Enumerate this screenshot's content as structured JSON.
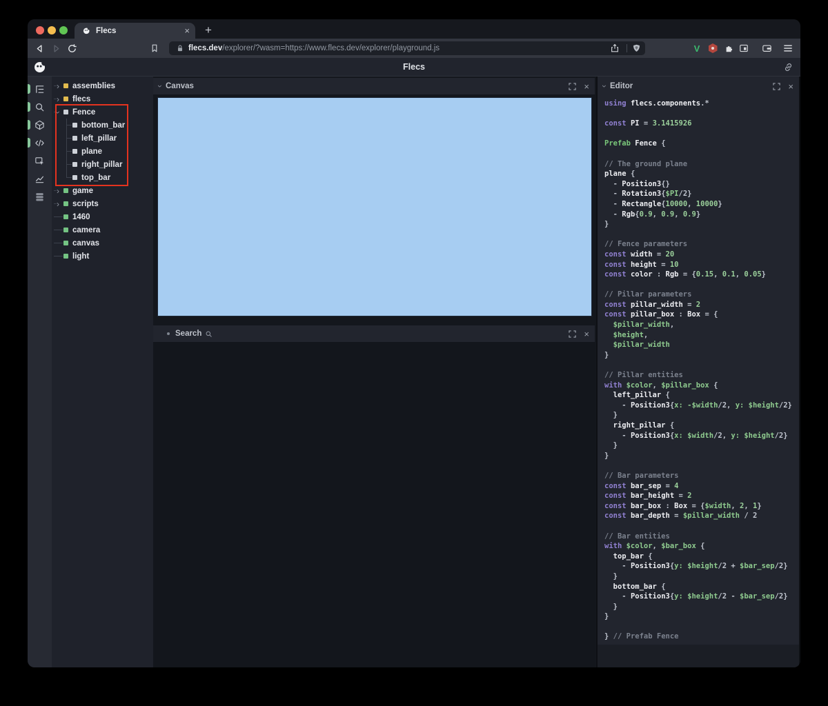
{
  "icons": {
    "close": "×",
    "plus": "+",
    "chevron": "›",
    "link": "link-icon",
    "lock": "lock-icon",
    "search": "magnifier-icon"
  },
  "browser": {
    "tab_title": "Flecs",
    "url_domain": "flecs.dev",
    "url_path": "/explorer/?wasm=https://www.flecs.dev/explorer/playground.js",
    "extensions": [
      "vue-devtools",
      "red-hexagon-extension",
      "extensions-puzzle",
      "reader-panel",
      "wallet",
      "menu"
    ]
  },
  "app_header": {
    "title": "Flecs"
  },
  "sidebar": {
    "active_color": "#87c79b",
    "icons": [
      {
        "name": "outliner-tree-icon",
        "active": true
      },
      {
        "name": "search-icon",
        "active": true
      },
      {
        "name": "scene-cube-icon",
        "active": true
      },
      {
        "name": "code-icon",
        "active": true
      },
      {
        "name": "inspector-icon",
        "active": false
      },
      {
        "name": "stats-chart-icon",
        "active": false
      },
      {
        "name": "rows-stack-icon",
        "active": false
      }
    ]
  },
  "tree": {
    "items": [
      {
        "label": "assemblies",
        "marker": "collapsed",
        "color": "#e2bb4e",
        "depth": 0
      },
      {
        "label": "flecs",
        "marker": "collapsed",
        "color": "#e2bb4e",
        "depth": 0
      },
      {
        "label": "Fence",
        "marker": "expanded",
        "color": "#ccd0d7",
        "depth": 0
      },
      {
        "label": "bottom_bar",
        "marker": "child",
        "color": "#ccd0d7",
        "depth": 1
      },
      {
        "label": "left_pillar",
        "marker": "child",
        "color": "#ccd0d7",
        "depth": 1
      },
      {
        "label": "plane",
        "marker": "child",
        "color": "#ccd0d7",
        "depth": 1
      },
      {
        "label": "right_pillar",
        "marker": "child",
        "color": "#ccd0d7",
        "depth": 1
      },
      {
        "label": "top_bar",
        "marker": "child",
        "color": "#ccd0d7",
        "depth": 1,
        "last": true
      },
      {
        "label": "game",
        "marker": "collapsed",
        "color": "#74c383",
        "depth": 0
      },
      {
        "label": "scripts",
        "marker": "collapsed",
        "color": "#74c383",
        "depth": 0
      },
      {
        "label": "1460",
        "marker": "leaf",
        "color": "#74c383",
        "depth": 0
      },
      {
        "label": "camera",
        "marker": "leaf",
        "color": "#74c383",
        "depth": 0
      },
      {
        "label": "canvas",
        "marker": "leaf",
        "color": "#74c383",
        "depth": 0
      },
      {
        "label": "light",
        "marker": "leaf",
        "color": "#74c383",
        "depth": 0
      }
    ],
    "annotation_color": "#e5331f"
  },
  "panels": {
    "canvas_title": "Canvas",
    "search_title": "Search",
    "editor_title": "Editor"
  },
  "colors": {
    "canvas_blue": "#a7cdf2",
    "annotation_red": "#e5331f",
    "active_green": "#87c79b"
  },
  "editor": {
    "lines": [
      [
        [
          "k",
          "using "
        ],
        [
          "i",
          "flecs.components"
        ],
        [
          "p",
          ".*"
        ]
      ],
      [],
      [
        [
          "k",
          "const "
        ],
        [
          "i",
          "PI "
        ],
        [
          "p",
          "= "
        ],
        [
          "n",
          "3.1415926"
        ]
      ],
      [],
      [
        [
          "g",
          "Prefab "
        ],
        [
          "i",
          "Fence "
        ],
        [
          "p",
          "{"
        ]
      ],
      [],
      [
        [
          "c",
          "// The ground plane"
        ]
      ],
      [
        [
          "i",
          "plane "
        ],
        [
          "p",
          "{"
        ]
      ],
      [
        [
          "p",
          "  - "
        ],
        [
          "i",
          "Position3"
        ],
        [
          "p",
          "{}"
        ]
      ],
      [
        [
          "p",
          "  - "
        ],
        [
          "i",
          "Rotation3"
        ],
        [
          "p",
          "{"
        ],
        [
          "v",
          "$PI"
        ],
        [
          "p",
          "/2}"
        ]
      ],
      [
        [
          "p",
          "  - "
        ],
        [
          "i",
          "Rectangle"
        ],
        [
          "p",
          "{"
        ],
        [
          "n",
          "10000"
        ],
        [
          "p",
          ", "
        ],
        [
          "n",
          "10000"
        ],
        [
          "p",
          "}"
        ]
      ],
      [
        [
          "p",
          "  - "
        ],
        [
          "i",
          "Rgb"
        ],
        [
          "p",
          "{"
        ],
        [
          "n",
          "0.9"
        ],
        [
          "p",
          ", "
        ],
        [
          "n",
          "0.9"
        ],
        [
          "p",
          ", "
        ],
        [
          "n",
          "0.9"
        ],
        [
          "p",
          "}"
        ]
      ],
      [
        [
          "p",
          "}"
        ]
      ],
      [],
      [
        [
          "c",
          "// Fence parameters"
        ]
      ],
      [
        [
          "k",
          "const "
        ],
        [
          "i",
          "width "
        ],
        [
          "p",
          "= "
        ],
        [
          "n",
          "20"
        ]
      ],
      [
        [
          "k",
          "const "
        ],
        [
          "i",
          "height "
        ],
        [
          "p",
          "= "
        ],
        [
          "n",
          "10"
        ]
      ],
      [
        [
          "k",
          "const "
        ],
        [
          "i",
          "color "
        ],
        [
          "p",
          ": "
        ],
        [
          "i",
          "Rgb "
        ],
        [
          "p",
          "= {"
        ],
        [
          "n",
          "0.15"
        ],
        [
          "p",
          ", "
        ],
        [
          "n",
          "0.1"
        ],
        [
          "p",
          ", "
        ],
        [
          "n",
          "0.05"
        ],
        [
          "p",
          "}"
        ]
      ],
      [],
      [
        [
          "c",
          "// Pillar parameters"
        ]
      ],
      [
        [
          "k",
          "const "
        ],
        [
          "i",
          "pillar_width "
        ],
        [
          "p",
          "= "
        ],
        [
          "n",
          "2"
        ]
      ],
      [
        [
          "k",
          "const "
        ],
        [
          "i",
          "pillar_box "
        ],
        [
          "p",
          ": "
        ],
        [
          "i",
          "Box "
        ],
        [
          "p",
          "= {"
        ]
      ],
      [
        [
          "v",
          "  $pillar_width"
        ],
        [
          "p",
          ","
        ]
      ],
      [
        [
          "v",
          "  $height"
        ],
        [
          "p",
          ","
        ]
      ],
      [
        [
          "v",
          "  $pillar_width"
        ]
      ],
      [
        [
          "p",
          "}"
        ]
      ],
      [],
      [
        [
          "c",
          "// Pillar entities"
        ]
      ],
      [
        [
          "k",
          "with "
        ],
        [
          "v",
          "$color"
        ],
        [
          "p",
          ", "
        ],
        [
          "v",
          "$pillar_box"
        ],
        [
          "p",
          " {"
        ]
      ],
      [
        [
          "i",
          "  left_pillar "
        ],
        [
          "p",
          "{"
        ]
      ],
      [
        [
          "p",
          "    - "
        ],
        [
          "i",
          "Position3"
        ],
        [
          "p",
          "{"
        ],
        [
          "v",
          "x: -$width"
        ],
        [
          "p",
          "/2, "
        ],
        [
          "v",
          "y: $height"
        ],
        [
          "p",
          "/2}"
        ]
      ],
      [
        [
          "p",
          "  }"
        ]
      ],
      [
        [
          "i",
          "  right_pillar "
        ],
        [
          "p",
          "{"
        ]
      ],
      [
        [
          "p",
          "    - "
        ],
        [
          "i",
          "Position3"
        ],
        [
          "p",
          "{"
        ],
        [
          "v",
          "x: $width"
        ],
        [
          "p",
          "/2, "
        ],
        [
          "v",
          "y: $height"
        ],
        [
          "p",
          "/2}"
        ]
      ],
      [
        [
          "p",
          "  }"
        ]
      ],
      [
        [
          "p",
          "}"
        ]
      ],
      [],
      [
        [
          "c",
          "// Bar parameters"
        ]
      ],
      [
        [
          "k",
          "const "
        ],
        [
          "i",
          "bar_sep "
        ],
        [
          "p",
          "= "
        ],
        [
          "n",
          "4"
        ]
      ],
      [
        [
          "k",
          "const "
        ],
        [
          "i",
          "bar_height "
        ],
        [
          "p",
          "= "
        ],
        [
          "n",
          "2"
        ]
      ],
      [
        [
          "k",
          "const "
        ],
        [
          "i",
          "bar_box "
        ],
        [
          "p",
          ": "
        ],
        [
          "i",
          "Box "
        ],
        [
          "p",
          "= {"
        ],
        [
          "v",
          "$width"
        ],
        [
          "p",
          ", "
        ],
        [
          "n",
          "2"
        ],
        [
          "p",
          ", "
        ],
        [
          "n",
          "1"
        ],
        [
          "p",
          "}"
        ]
      ],
      [
        [
          "k",
          "const "
        ],
        [
          "i",
          "bar_depth "
        ],
        [
          "p",
          "= "
        ],
        [
          "v",
          "$pillar_width"
        ],
        [
          "p",
          " / 2"
        ]
      ],
      [],
      [
        [
          "c",
          "// Bar entities"
        ]
      ],
      [
        [
          "k",
          "with "
        ],
        [
          "v",
          "$color"
        ],
        [
          "p",
          ", "
        ],
        [
          "v",
          "$bar_box"
        ],
        [
          "p",
          " {"
        ]
      ],
      [
        [
          "i",
          "  top_bar "
        ],
        [
          "p",
          "{"
        ]
      ],
      [
        [
          "p",
          "    - "
        ],
        [
          "i",
          "Position3"
        ],
        [
          "p",
          "{"
        ],
        [
          "v",
          "y: $height"
        ],
        [
          "p",
          "/2 + "
        ],
        [
          "v",
          "$bar_sep"
        ],
        [
          "p",
          "/2}"
        ]
      ],
      [
        [
          "p",
          "  }"
        ]
      ],
      [
        [
          "i",
          "  bottom_bar "
        ],
        [
          "p",
          "{"
        ]
      ],
      [
        [
          "p",
          "    - "
        ],
        [
          "i",
          "Position3"
        ],
        [
          "p",
          "{"
        ],
        [
          "v",
          "y: $height"
        ],
        [
          "p",
          "/2 - "
        ],
        [
          "v",
          "$bar_sep"
        ],
        [
          "p",
          "/2}"
        ]
      ],
      [
        [
          "p",
          "  }"
        ]
      ],
      [
        [
          "p",
          "}"
        ]
      ],
      [],
      [
        [
          "p",
          "} "
        ],
        [
          "c",
          "// Prefab Fence"
        ]
      ]
    ]
  }
}
